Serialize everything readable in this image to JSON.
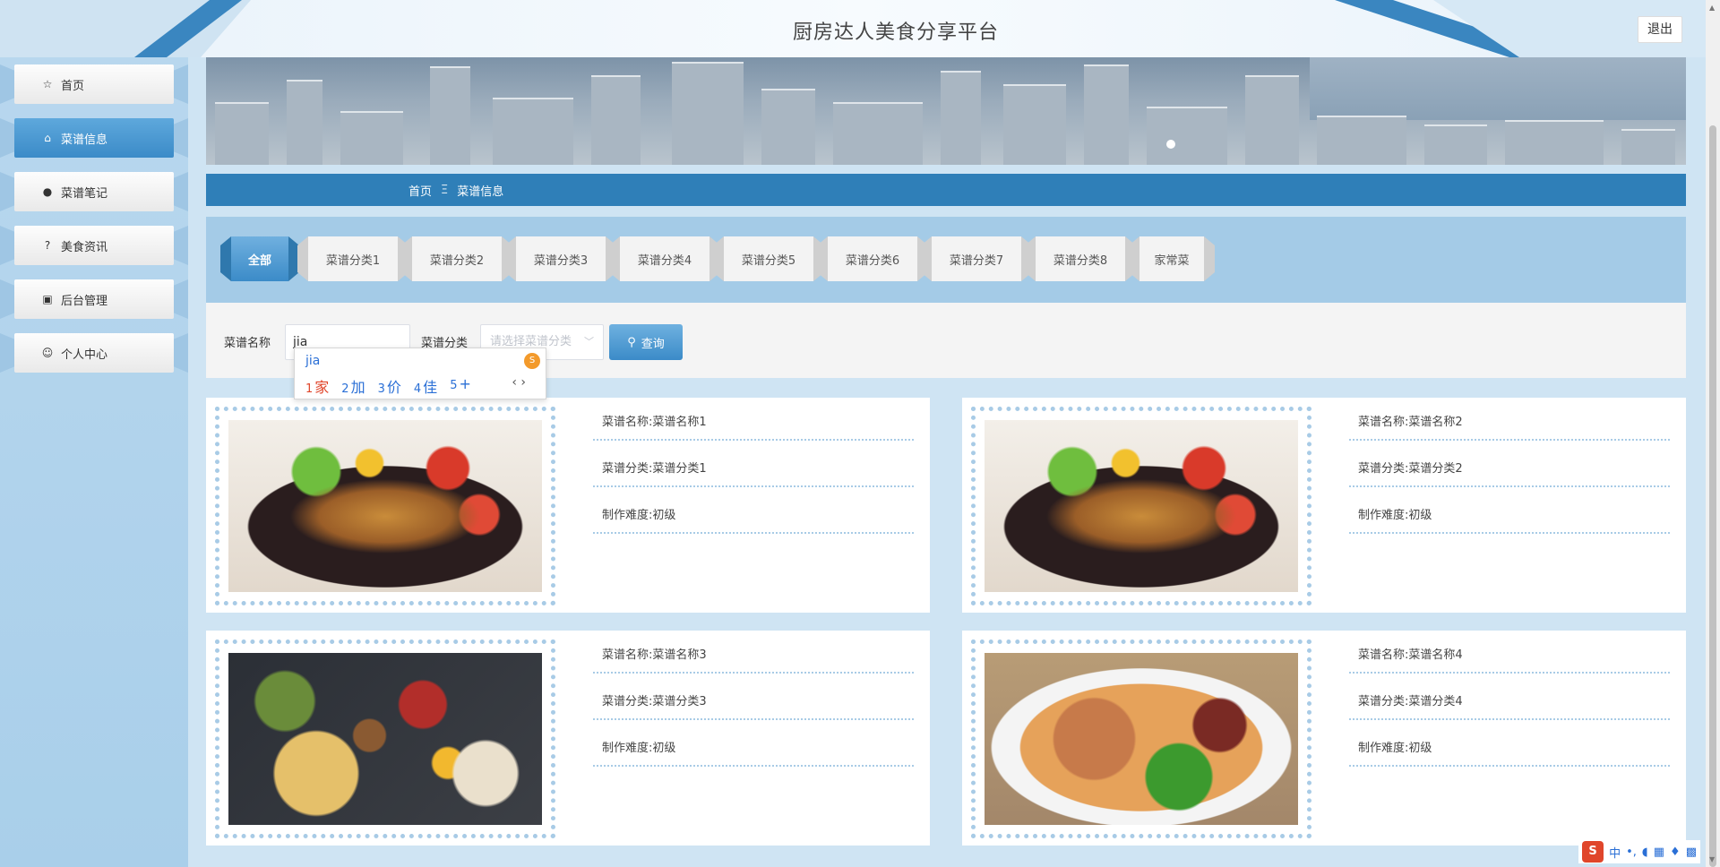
{
  "header": {
    "title": "厨房达人美食分享平台",
    "logout_label": "退出"
  },
  "sidebar": {
    "items": [
      {
        "label": "首页",
        "icon": "star-icon",
        "glyph": "☆",
        "active": false
      },
      {
        "label": "菜谱信息",
        "icon": "bag-icon",
        "glyph": "⌂",
        "active": true
      },
      {
        "label": "菜谱笔记",
        "icon": "info-icon",
        "glyph": "●",
        "active": false
      },
      {
        "label": "美食资讯",
        "icon": "question-icon",
        "glyph": "?",
        "active": false
      },
      {
        "label": "后台管理",
        "icon": "briefcase-icon",
        "glyph": "▣",
        "active": false
      },
      {
        "label": "个人中心",
        "icon": "user-icon",
        "glyph": "☺",
        "active": false
      }
    ]
  },
  "breadcrumb": {
    "home": "首页",
    "separator": "Ξ",
    "current": "菜谱信息"
  },
  "categories": [
    "全部",
    "菜谱分类1",
    "菜谱分类2",
    "菜谱分类3",
    "菜谱分类4",
    "菜谱分类5",
    "菜谱分类6",
    "菜谱分类7",
    "菜谱分类8",
    "家常菜"
  ],
  "search": {
    "name_label": "菜谱名称",
    "name_value": "jia",
    "category_label": "菜谱分类",
    "category_placeholder": "请选择菜谱分类",
    "query_label": "查询"
  },
  "ime_popup": {
    "pinyin": "jia",
    "candidates": [
      {
        "n": "1",
        "ch": "家"
      },
      {
        "n": "2",
        "ch": "加"
      },
      {
        "n": "3",
        "ch": "价"
      },
      {
        "n": "4",
        "ch": "佳"
      },
      {
        "n": "5",
        "ch": "+"
      }
    ]
  },
  "recipes": [
    {
      "name": "菜谱名称:菜谱名称1",
      "category": "菜谱分类:菜谱分类1",
      "difficulty": "制作难度:初级",
      "image": "wok-stew"
    },
    {
      "name": "菜谱名称:菜谱名称2",
      "category": "菜谱分类:菜谱分类2",
      "difficulty": "制作难度:初级",
      "image": "wok-stew"
    },
    {
      "name": "菜谱名称:菜谱名称3",
      "category": "菜谱分类:菜谱分类3",
      "difficulty": "制作难度:初级",
      "image": "feast-table"
    },
    {
      "name": "菜谱名称:菜谱名称4",
      "category": "菜谱分类:菜谱分类4",
      "difficulty": "制作难度:初级",
      "image": "noodle-bowl"
    }
  ],
  "tray": {
    "lang": "中"
  }
}
